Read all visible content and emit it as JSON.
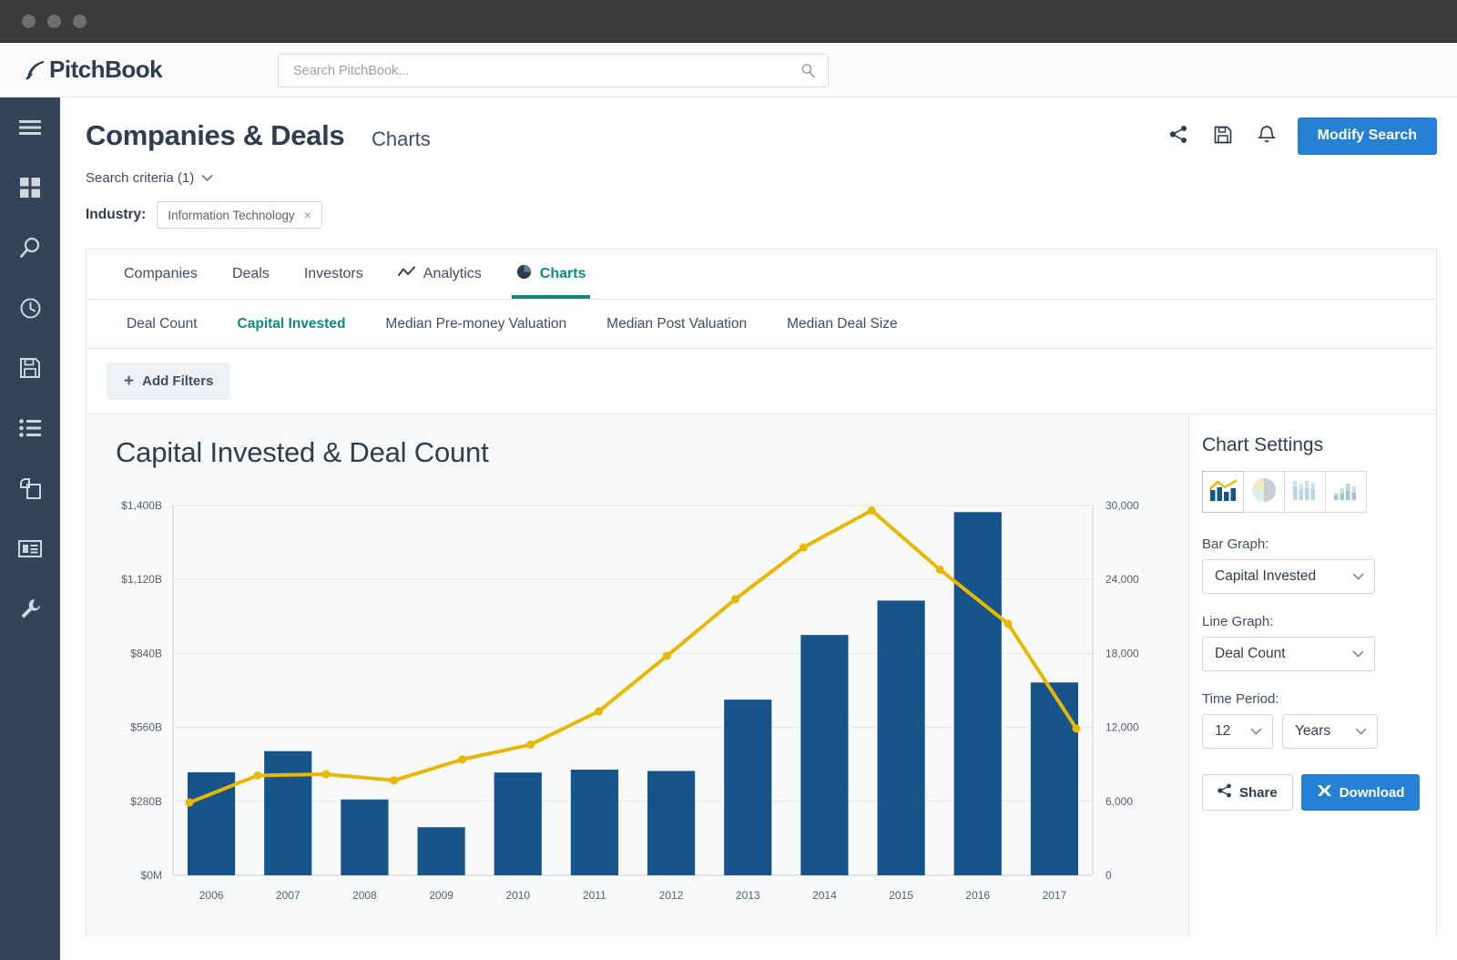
{
  "window": {
    "dots": 3
  },
  "brand": {
    "name": "PitchBook"
  },
  "search": {
    "placeholder": "Search PitchBook...",
    "value": "",
    "icon": "search-icon"
  },
  "sidebar": {
    "items": [
      {
        "name": "menu-icon",
        "label": "Menu"
      },
      {
        "name": "dashboard-icon",
        "label": "Dashboard"
      },
      {
        "name": "search-icon",
        "label": "Search"
      },
      {
        "name": "recent-icon",
        "label": "Recent"
      },
      {
        "name": "saved-icon",
        "label": "Saved"
      },
      {
        "name": "lists-icon",
        "label": "Lists"
      },
      {
        "name": "files-icon",
        "label": "Files"
      },
      {
        "name": "news-icon",
        "label": "News"
      },
      {
        "name": "tools-icon",
        "label": "Tools"
      }
    ]
  },
  "header": {
    "title": "Companies & Deals",
    "subtitle": "Charts",
    "actions": [
      {
        "name": "share-icon",
        "label": "Share"
      },
      {
        "name": "save-icon",
        "label": "Save"
      },
      {
        "name": "bell-icon",
        "label": "Alerts"
      }
    ],
    "modify_search_label": "Modify Search"
  },
  "criteria": {
    "toggle_label": "Search criteria (1)",
    "industry_label": "Industry:",
    "chips": [
      {
        "label": "Information Technology",
        "remove": "×"
      }
    ]
  },
  "tabs": [
    {
      "label": "Companies",
      "icon": null,
      "active": false
    },
    {
      "label": "Deals",
      "icon": null,
      "active": false
    },
    {
      "label": "Investors",
      "icon": null,
      "active": false
    },
    {
      "label": "Analytics",
      "icon": "line-chart-icon",
      "active": false
    },
    {
      "label": "Charts",
      "icon": "pie-chart-icon",
      "active": true
    }
  ],
  "subtabs": [
    {
      "label": "Deal Count",
      "active": false
    },
    {
      "label": "Capital Invested",
      "active": true
    },
    {
      "label": "Median Pre-money Valuation",
      "active": false
    },
    {
      "label": "Median Post Valuation",
      "active": false
    },
    {
      "label": "Median Deal Size",
      "active": false
    }
  ],
  "filters": {
    "add_label": "Add Filters",
    "plus": "+"
  },
  "settings": {
    "heading": "Chart Settings",
    "chart_types": [
      {
        "name": "combo-bar-line-chart-icon",
        "active": true
      },
      {
        "name": "pie-chart-icon",
        "active": false
      },
      {
        "name": "grouped-bar-chart-icon",
        "active": false
      },
      {
        "name": "stacked-bar-chart-icon",
        "active": false
      }
    ],
    "bar_graph_label": "Bar Graph:",
    "bar_graph_value": "Capital Invested",
    "line_graph_label": "Line Graph:",
    "line_graph_value": "Deal Count",
    "time_period_label": "Time Period:",
    "time_period_count": "12",
    "time_period_unit": "Years",
    "share_label": "Share",
    "download_label": "Download"
  },
  "colors": {
    "bar": "#17548a",
    "line": "#e8b800",
    "accent_teal": "#0c8a80",
    "accent_blue": "#2681d4",
    "sidebar": "#334358",
    "title": "#2c3e50"
  },
  "chart_data": {
    "type": "bar",
    "title": "Capital Invested & Deal Count",
    "categories": [
      "2006",
      "2007",
      "2008",
      "2009",
      "2010",
      "2011",
      "2012",
      "2013",
      "2014",
      "2015",
      "2016",
      "2017"
    ],
    "series": [
      {
        "name": "Capital Invested",
        "kind": "bar",
        "unit": "$B",
        "axis": "left",
        "values": [
          390,
          470,
          287,
          182,
          389,
          400,
          395,
          665,
          910,
          1040,
          1375,
          730
        ]
      },
      {
        "name": "Deal Count",
        "kind": "line",
        "unit": "",
        "axis": "right",
        "values": [
          5900,
          8100,
          8200,
          7700,
          9400,
          10600,
          13300,
          17800,
          22400,
          26600,
          29600,
          24800,
          20400,
          11900
        ]
      }
    ],
    "line_values": [
      5900,
      8100,
      8200,
      7700,
      9400,
      10600,
      13300,
      17800,
      22400,
      26600,
      29600,
      24800,
      20400,
      11900
    ],
    "xlabel": "",
    "ylabel_left": "",
    "ylabel_right": "",
    "yticks_left": [
      "$0M",
      "$280B",
      "$560B",
      "$840B",
      "$1,120B",
      "$1,400B"
    ],
    "yticks_right": [
      "0",
      "6,000",
      "12,000",
      "18,000",
      "24,000",
      "30,000"
    ],
    "ylim_left": [
      0,
      1400
    ],
    "ylim_right": [
      0,
      30000
    ],
    "grid": true,
    "legend": "none"
  }
}
